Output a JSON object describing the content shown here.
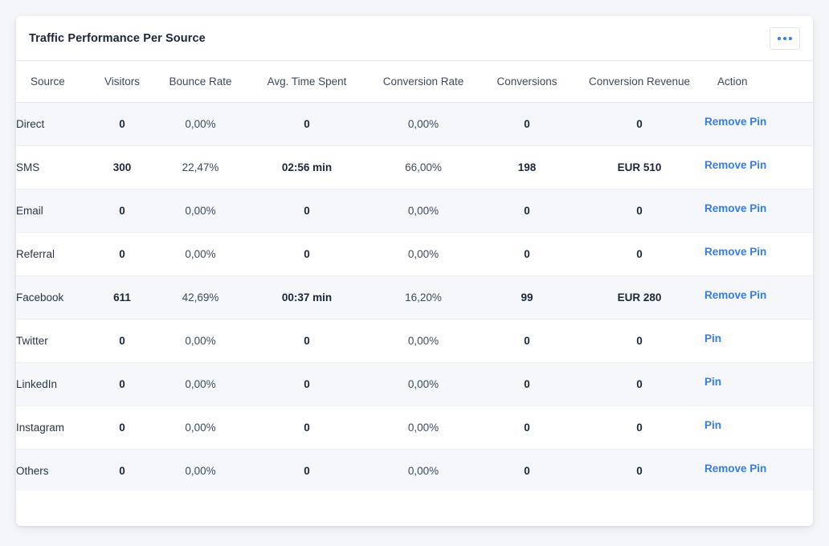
{
  "card": {
    "title": "Traffic Performance Per Source",
    "menu_button": {
      "name": "more-options",
      "icon": "ellipsis-horizontal-icon",
      "label": "..."
    }
  },
  "colors": {
    "accent": "#2f7df4",
    "page_background": "#f4f6f9",
    "card_background": "#ffffff",
    "row_striped": "#f5f7fa",
    "border": "#e3e7ec",
    "title_text": "#1b2738",
    "header_text": "#3d4a5c"
  },
  "table": {
    "columns": [
      {
        "key": "source",
        "label": "Source"
      },
      {
        "key": "visitors",
        "label": "Visitors"
      },
      {
        "key": "bounce_rate",
        "label": "Bounce Rate"
      },
      {
        "key": "avg_time_spent",
        "label": "Avg. Time Spent"
      },
      {
        "key": "conversion_rate",
        "label": "Conversion Rate"
      },
      {
        "key": "conversions",
        "label": "Conversions"
      },
      {
        "key": "conversion_revenue",
        "label": "Conversion Revenue"
      },
      {
        "key": "action",
        "label": "Action"
      }
    ],
    "rows": [
      {
        "source": "Direct",
        "visitors": "0",
        "bounce_rate": "0,00%",
        "avg_time_spent": "0",
        "conversion_rate": "0,00%",
        "conversions": "0",
        "conversion_revenue": "0",
        "action": "Remove Pin"
      },
      {
        "source": "SMS",
        "visitors": "300",
        "bounce_rate": "22,47%",
        "avg_time_spent": "02:56 min",
        "conversion_rate": "66,00%",
        "conversions": "198",
        "conversion_revenue": "EUR 510",
        "action": "Remove Pin"
      },
      {
        "source": "Email",
        "visitors": "0",
        "bounce_rate": "0,00%",
        "avg_time_spent": "0",
        "conversion_rate": "0,00%",
        "conversions": "0",
        "conversion_revenue": "0",
        "action": "Remove Pin"
      },
      {
        "source": "Referral",
        "visitors": "0",
        "bounce_rate": "0,00%",
        "avg_time_spent": "0",
        "conversion_rate": "0,00%",
        "conversions": "0",
        "conversion_revenue": "0",
        "action": "Remove Pin"
      },
      {
        "source": "Facebook",
        "visitors": "611",
        "bounce_rate": "42,69%",
        "avg_time_spent": "00:37 min",
        "conversion_rate": "16,20%",
        "conversions": "99",
        "conversion_revenue": "EUR 280",
        "action": "Remove Pin"
      },
      {
        "source": "Twitter",
        "visitors": "0",
        "bounce_rate": "0,00%",
        "avg_time_spent": "0",
        "conversion_rate": "0,00%",
        "conversions": "0",
        "conversion_revenue": "0",
        "action": "Pin"
      },
      {
        "source": "LinkedIn",
        "visitors": "0",
        "bounce_rate": "0,00%",
        "avg_time_spent": "0",
        "conversion_rate": "0,00%",
        "conversions": "0",
        "conversion_revenue": "0",
        "action": "Pin"
      },
      {
        "source": "Instagram",
        "visitors": "0",
        "bounce_rate": "0,00%",
        "avg_time_spent": "0",
        "conversion_rate": "0,00%",
        "conversions": "0",
        "conversion_revenue": "0",
        "action": "Pin"
      },
      {
        "source": "Others",
        "visitors": "0",
        "bounce_rate": "0,00%",
        "avg_time_spent": "0",
        "conversion_rate": "0,00%",
        "conversions": "0",
        "conversion_revenue": "0",
        "action": "Remove Pin"
      }
    ]
  }
}
